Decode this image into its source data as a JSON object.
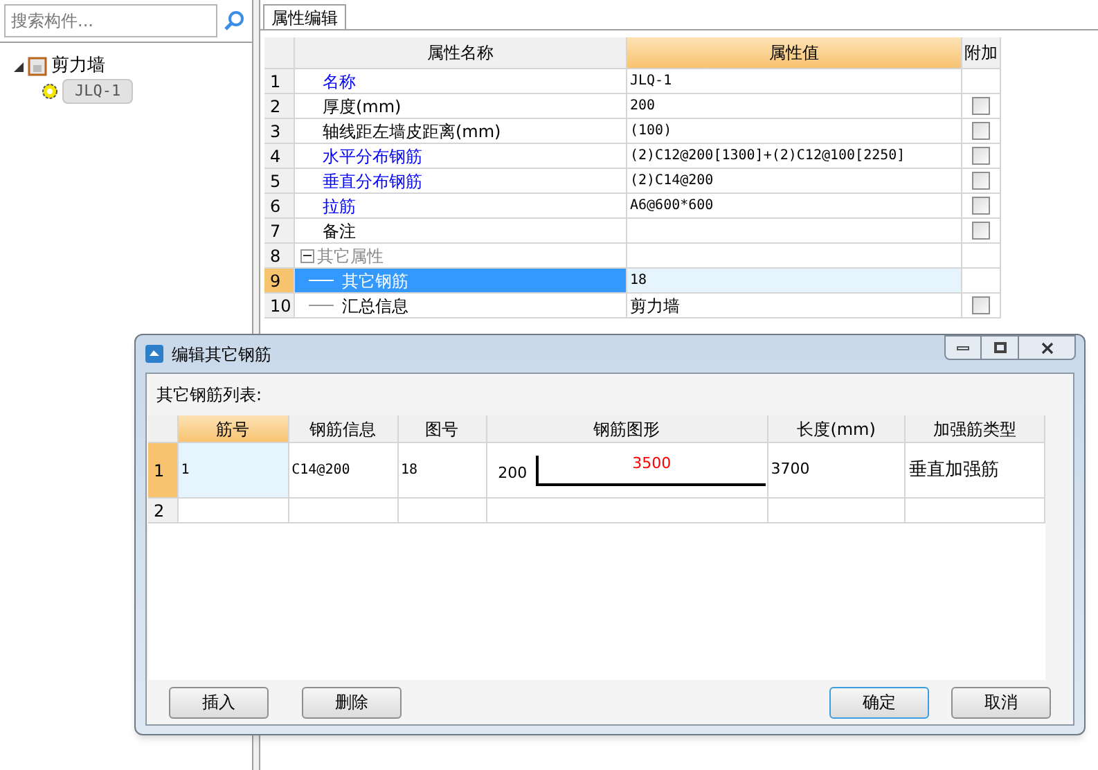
{
  "search": {
    "placeholder": "搜索构件..."
  },
  "tree": [
    {
      "label": "剪力墙",
      "expanded": true,
      "children": [
        {
          "label": "JLQ-1",
          "selected": true
        }
      ]
    }
  ],
  "tabs": [
    {
      "label": "属性编辑",
      "selected": true
    }
  ],
  "property_table": {
    "columns": [
      {
        "label": "属性名称",
        "selected": false
      },
      {
        "label": "属性值",
        "selected": true
      },
      {
        "label": "附加",
        "selected": false
      }
    ],
    "rows": [
      {
        "index": "1",
        "kind": "link",
        "name": "名称",
        "value": "JLQ-1",
        "selected": false
      },
      {
        "index": "2",
        "kind": "plain",
        "name": "厚度(mm)",
        "value": "200",
        "selected": false,
        "checked": false
      },
      {
        "index": "3",
        "kind": "plain",
        "name": "轴线距左墙皮距离(mm)",
        "value": "(100)",
        "selected": false,
        "checked": false
      },
      {
        "index": "4",
        "kind": "link",
        "name": "水平分布钢筋",
        "value": "(2)C12@200[1300]+(2)C12@100[2250]",
        "selected": false,
        "checked": false
      },
      {
        "index": "5",
        "kind": "link",
        "name": "垂直分布钢筋",
        "value": "(2)C14@200",
        "selected": false,
        "checked": false
      },
      {
        "index": "6",
        "kind": "link",
        "name": "拉筋",
        "value": "A6@600*600",
        "selected": false,
        "checked": false
      },
      {
        "index": "7",
        "kind": "plain",
        "name": "备注",
        "value": "",
        "selected": false,
        "checked": false
      },
      {
        "index": "8",
        "kind": "group",
        "name": "其它属性",
        "expanded": true,
        "selected": false
      },
      {
        "index": "9",
        "kind": "child",
        "name": "其它钢筋",
        "value": "18",
        "selected": true
      },
      {
        "index": "10",
        "kind": "child",
        "name": "汇总信息",
        "value": "剪力墙",
        "selected": false,
        "checked": false
      }
    ]
  },
  "dialog": {
    "title": "编辑其它钢筋",
    "list_label": "其它钢筋列表:",
    "columns": [
      {
        "label": "筋号",
        "selected": true
      },
      {
        "label": "钢筋信息",
        "selected": false
      },
      {
        "label": "图号",
        "selected": false
      },
      {
        "label": "钢筋图形",
        "selected": false
      },
      {
        "label": "长度(mm)",
        "selected": false
      },
      {
        "label": "加强筋类型",
        "selected": false
      }
    ],
    "rows": [
      {
        "index": "1",
        "selected": true,
        "bar_no": "1",
        "bar_info": "C14@200",
        "shape_no": "18",
        "shape": {
          "left_label": "200",
          "top_label": "3500"
        },
        "length": "3700",
        "type": "垂直加强筋"
      },
      {
        "index": "2",
        "selected": false
      }
    ],
    "buttons": [
      {
        "label": "插入",
        "default": false
      },
      {
        "label": "删除",
        "default": false
      },
      {
        "label": "确定",
        "default": true
      },
      {
        "label": "取消",
        "default": false
      }
    ]
  }
}
